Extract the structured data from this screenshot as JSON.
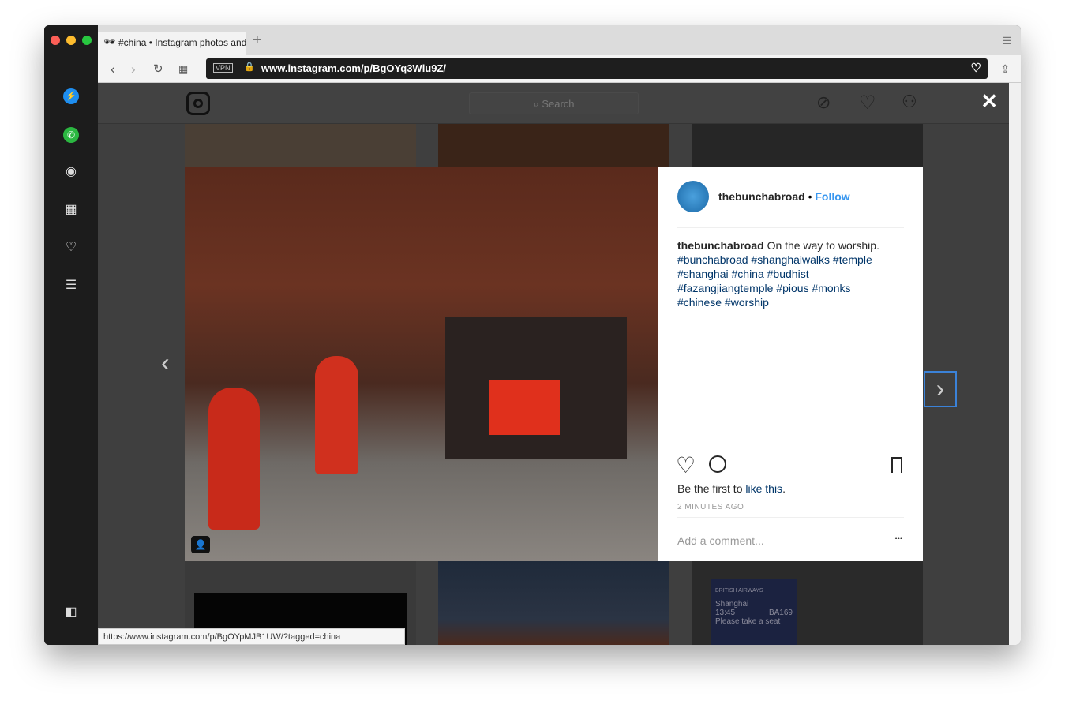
{
  "browser": {
    "tab_title": "#china • Instagram photos and videos",
    "url": "www.instagram.com/p/BgOYq3Wlu9Z/",
    "vpn_label": "VPN",
    "status_url": "https://www.instagram.com/p/BgOYpMJB1UW/?tagged=china"
  },
  "sidebar": {
    "items": [
      "messenger-icon",
      "whatsapp-icon",
      "camera-icon",
      "grid-icon",
      "heart-icon",
      "news-icon"
    ]
  },
  "header": {
    "search_placeholder": "Search"
  },
  "post": {
    "username": "thebunchabroad",
    "separator": "•",
    "follow": "Follow",
    "caption_text": "On the way to worship.",
    "hashtags": [
      "#bunchabroad #shanghaiwalks #temple",
      "#shanghai #china #budhist",
      "#fazangjiangtemple #pious #monks",
      "#chinese #worship"
    ],
    "likes_prefix": "Be the first to ",
    "likes_link": "like this",
    "likes_suffix": ".",
    "time": "2 MINUTES AGO",
    "comment_placeholder": "Add a comment...",
    "more": "•••"
  },
  "thumb_text": {
    "airline": "BRITISH AIRWAYS",
    "city": "Shanghai",
    "time": "13:45",
    "flight": "BA169",
    "note": "Please take a seat"
  }
}
